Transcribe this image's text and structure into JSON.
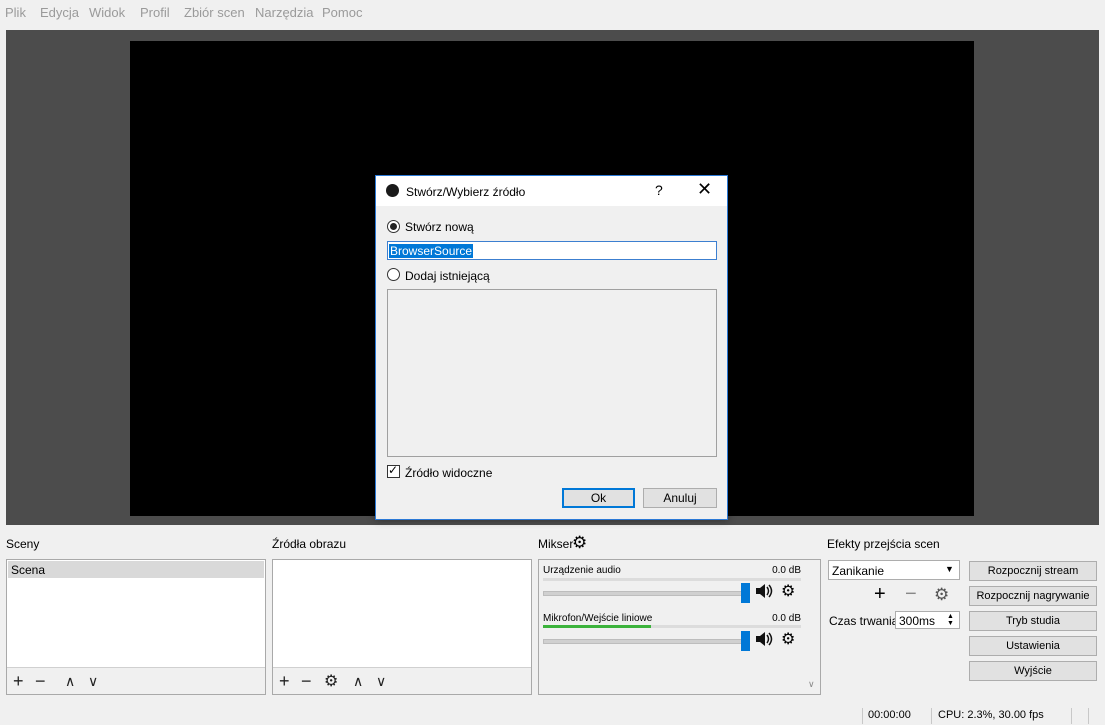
{
  "menu": [
    "Plik",
    "Edycja",
    "Widok",
    "Profil",
    "Zbiór scen",
    "Narzędzia",
    "Pomoc"
  ],
  "dialog": {
    "title": "Stwórz/Wybierz źródło",
    "help": "?",
    "close": "✕",
    "create_new_label": "Stwórz nową",
    "name_value": "BrowserSource",
    "add_existing_label": "Dodaj istniejącą",
    "visible_label": "Źródło widoczne",
    "ok_label": "Ok",
    "cancel_label": "Anuluj"
  },
  "scenes": {
    "title": "Sceny",
    "items": [
      "Scena"
    ]
  },
  "sources": {
    "title": "Źródła obrazu"
  },
  "mixer": {
    "title": "Mikser",
    "channels": [
      {
        "name": "Urządzenie audio",
        "db": "0.0 dB",
        "level": 0.0
      },
      {
        "name": "Mikrofon/Wejście liniowe",
        "db": "0.0 dB",
        "level": 0.42
      }
    ]
  },
  "transitions": {
    "title": "Efekty przejścia scen",
    "selected": "Zanikanie",
    "duration_label": "Czas trwania",
    "duration_value": "300ms"
  },
  "controls": [
    "Rozpocznij stream",
    "Rozpocznij nagrywanie",
    "Tryb studia",
    "Ustawienia",
    "Wyjście"
  ],
  "status": {
    "time": "00:00:00",
    "cpu": "CPU: 2.3%, 30.00 fps"
  },
  "icons": {
    "plus": "+",
    "minus": "−",
    "gear": "⚙",
    "up": "∧",
    "down": "∨",
    "speaker": "🔊"
  }
}
